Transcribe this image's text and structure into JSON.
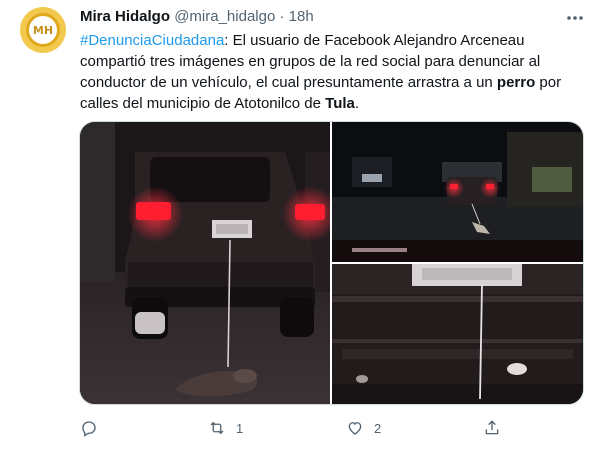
{
  "author": {
    "name": "Mira Hidalgo",
    "handle": "@mira_hidalgo",
    "separator": "·",
    "time": "18h",
    "avatar_text": "MH"
  },
  "tweet": {
    "hashtag": "#DenunciaCiudadana",
    "text_1": ": El usuario de Facebook Alejandro Arceneau compartió tres imágenes en grupos de la red social para denunciar al conductor de un vehículo, el cual presuntamente arrastra a un ",
    "bold_1": "perro",
    "text_2": " por calles del municipio de Atotonilco de ",
    "bold_2": "Tula",
    "text_3": "."
  },
  "actions": {
    "reply_count": "",
    "retweet_count": "1",
    "like_count": "2"
  },
  "icons": {
    "more": "more-icon",
    "reply": "reply-icon",
    "retweet": "retweet-icon",
    "like": "heart-icon",
    "share": "share-icon"
  },
  "colors": {
    "link": "#1d9bf0",
    "secondary": "#536471",
    "taillight": "#ff2030"
  }
}
